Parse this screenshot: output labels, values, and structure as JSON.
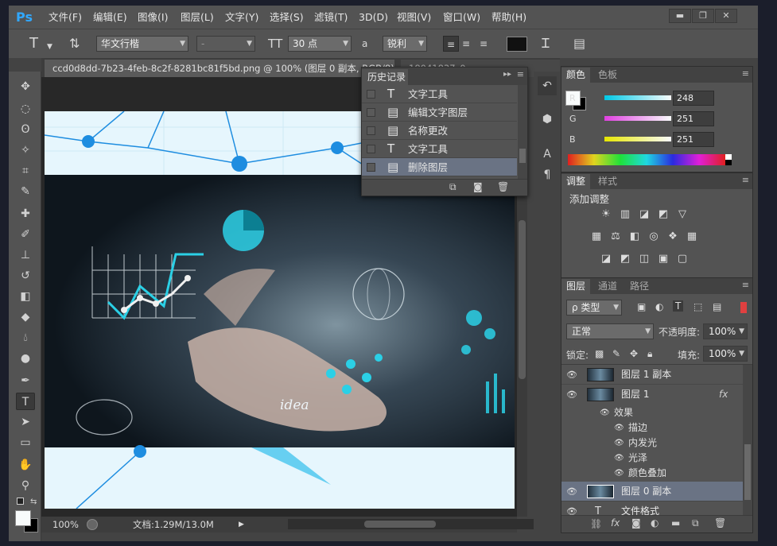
{
  "app": {
    "logo": "Ps",
    "menu": [
      "文件(F)",
      "编辑(E)",
      "图像(I)",
      "图层(L)",
      "文字(Y)",
      "选择(S)",
      "滤镜(T)",
      "3D(D)",
      "视图(V)",
      "窗口(W)",
      "帮助(H)"
    ],
    "window_buttons": [
      "▬",
      "❐",
      "✕"
    ]
  },
  "options": {
    "tool_icon": "T",
    "font_family": "华文行楷",
    "font_style": "-",
    "size_label": "30 点",
    "aa_icon": "a",
    "aa_mode": "锐利",
    "color": "#111111"
  },
  "tabs": {
    "active": "ccd0d8dd-7b23-4feb-8c2f-8281bc81f5bd.png @ 100% (图层 0 副本, RGB/8) *",
    "inactive": "18041837_0"
  },
  "history": {
    "title": "历史记录",
    "items": [
      {
        "icon": "T",
        "label": "文字工具"
      },
      {
        "icon": "▤",
        "label": "编辑文字图层"
      },
      {
        "icon": "▤",
        "label": "名称更改"
      },
      {
        "icon": "T",
        "label": "文字工具"
      },
      {
        "icon": "▤",
        "label": "删除图层"
      }
    ],
    "selected_index": 4
  },
  "color_panel": {
    "tabs": [
      "颜色",
      "色板"
    ],
    "channels": [
      {
        "name": "R",
        "value": "248",
        "gradient": "#00c8e6"
      },
      {
        "name": "G",
        "value": "251",
        "gradient": "#e040e0"
      },
      {
        "name": "B",
        "value": "251",
        "gradient": "#e6e600"
      }
    ],
    "fg_color": "#f8fbfb",
    "bg_color": "#000000"
  },
  "adjust_panel": {
    "tabs": [
      "调整",
      "样式"
    ],
    "heading": "添加调整"
  },
  "layers_panel": {
    "tabs": [
      "图层",
      "通道",
      "路径"
    ],
    "filter": "ρ 类型",
    "blend_mode": "正常",
    "opacity_label": "不透明度:",
    "opacity": "100%",
    "lock_label": "锁定:",
    "fill_label": "填充:",
    "fill": "100%",
    "layers": [
      {
        "name": "图层 1 副本",
        "type": "image",
        "fx": ""
      },
      {
        "name": "图层 1",
        "type": "image",
        "fx": "fx"
      },
      {
        "name": "图层 0 副本",
        "type": "image",
        "fx": "",
        "selected": true
      },
      {
        "name": "文件格式",
        "type": "text",
        "fx": ""
      }
    ],
    "effects_label": "效果",
    "effects": [
      "描边",
      "内发光",
      "光泽",
      "颜色叠加"
    ]
  },
  "status": {
    "zoom": "100%",
    "doc_info": "文档:1.29M/13.0M"
  },
  "canvas": {
    "idea_text": "idea",
    "accent": "#1e8de0"
  }
}
